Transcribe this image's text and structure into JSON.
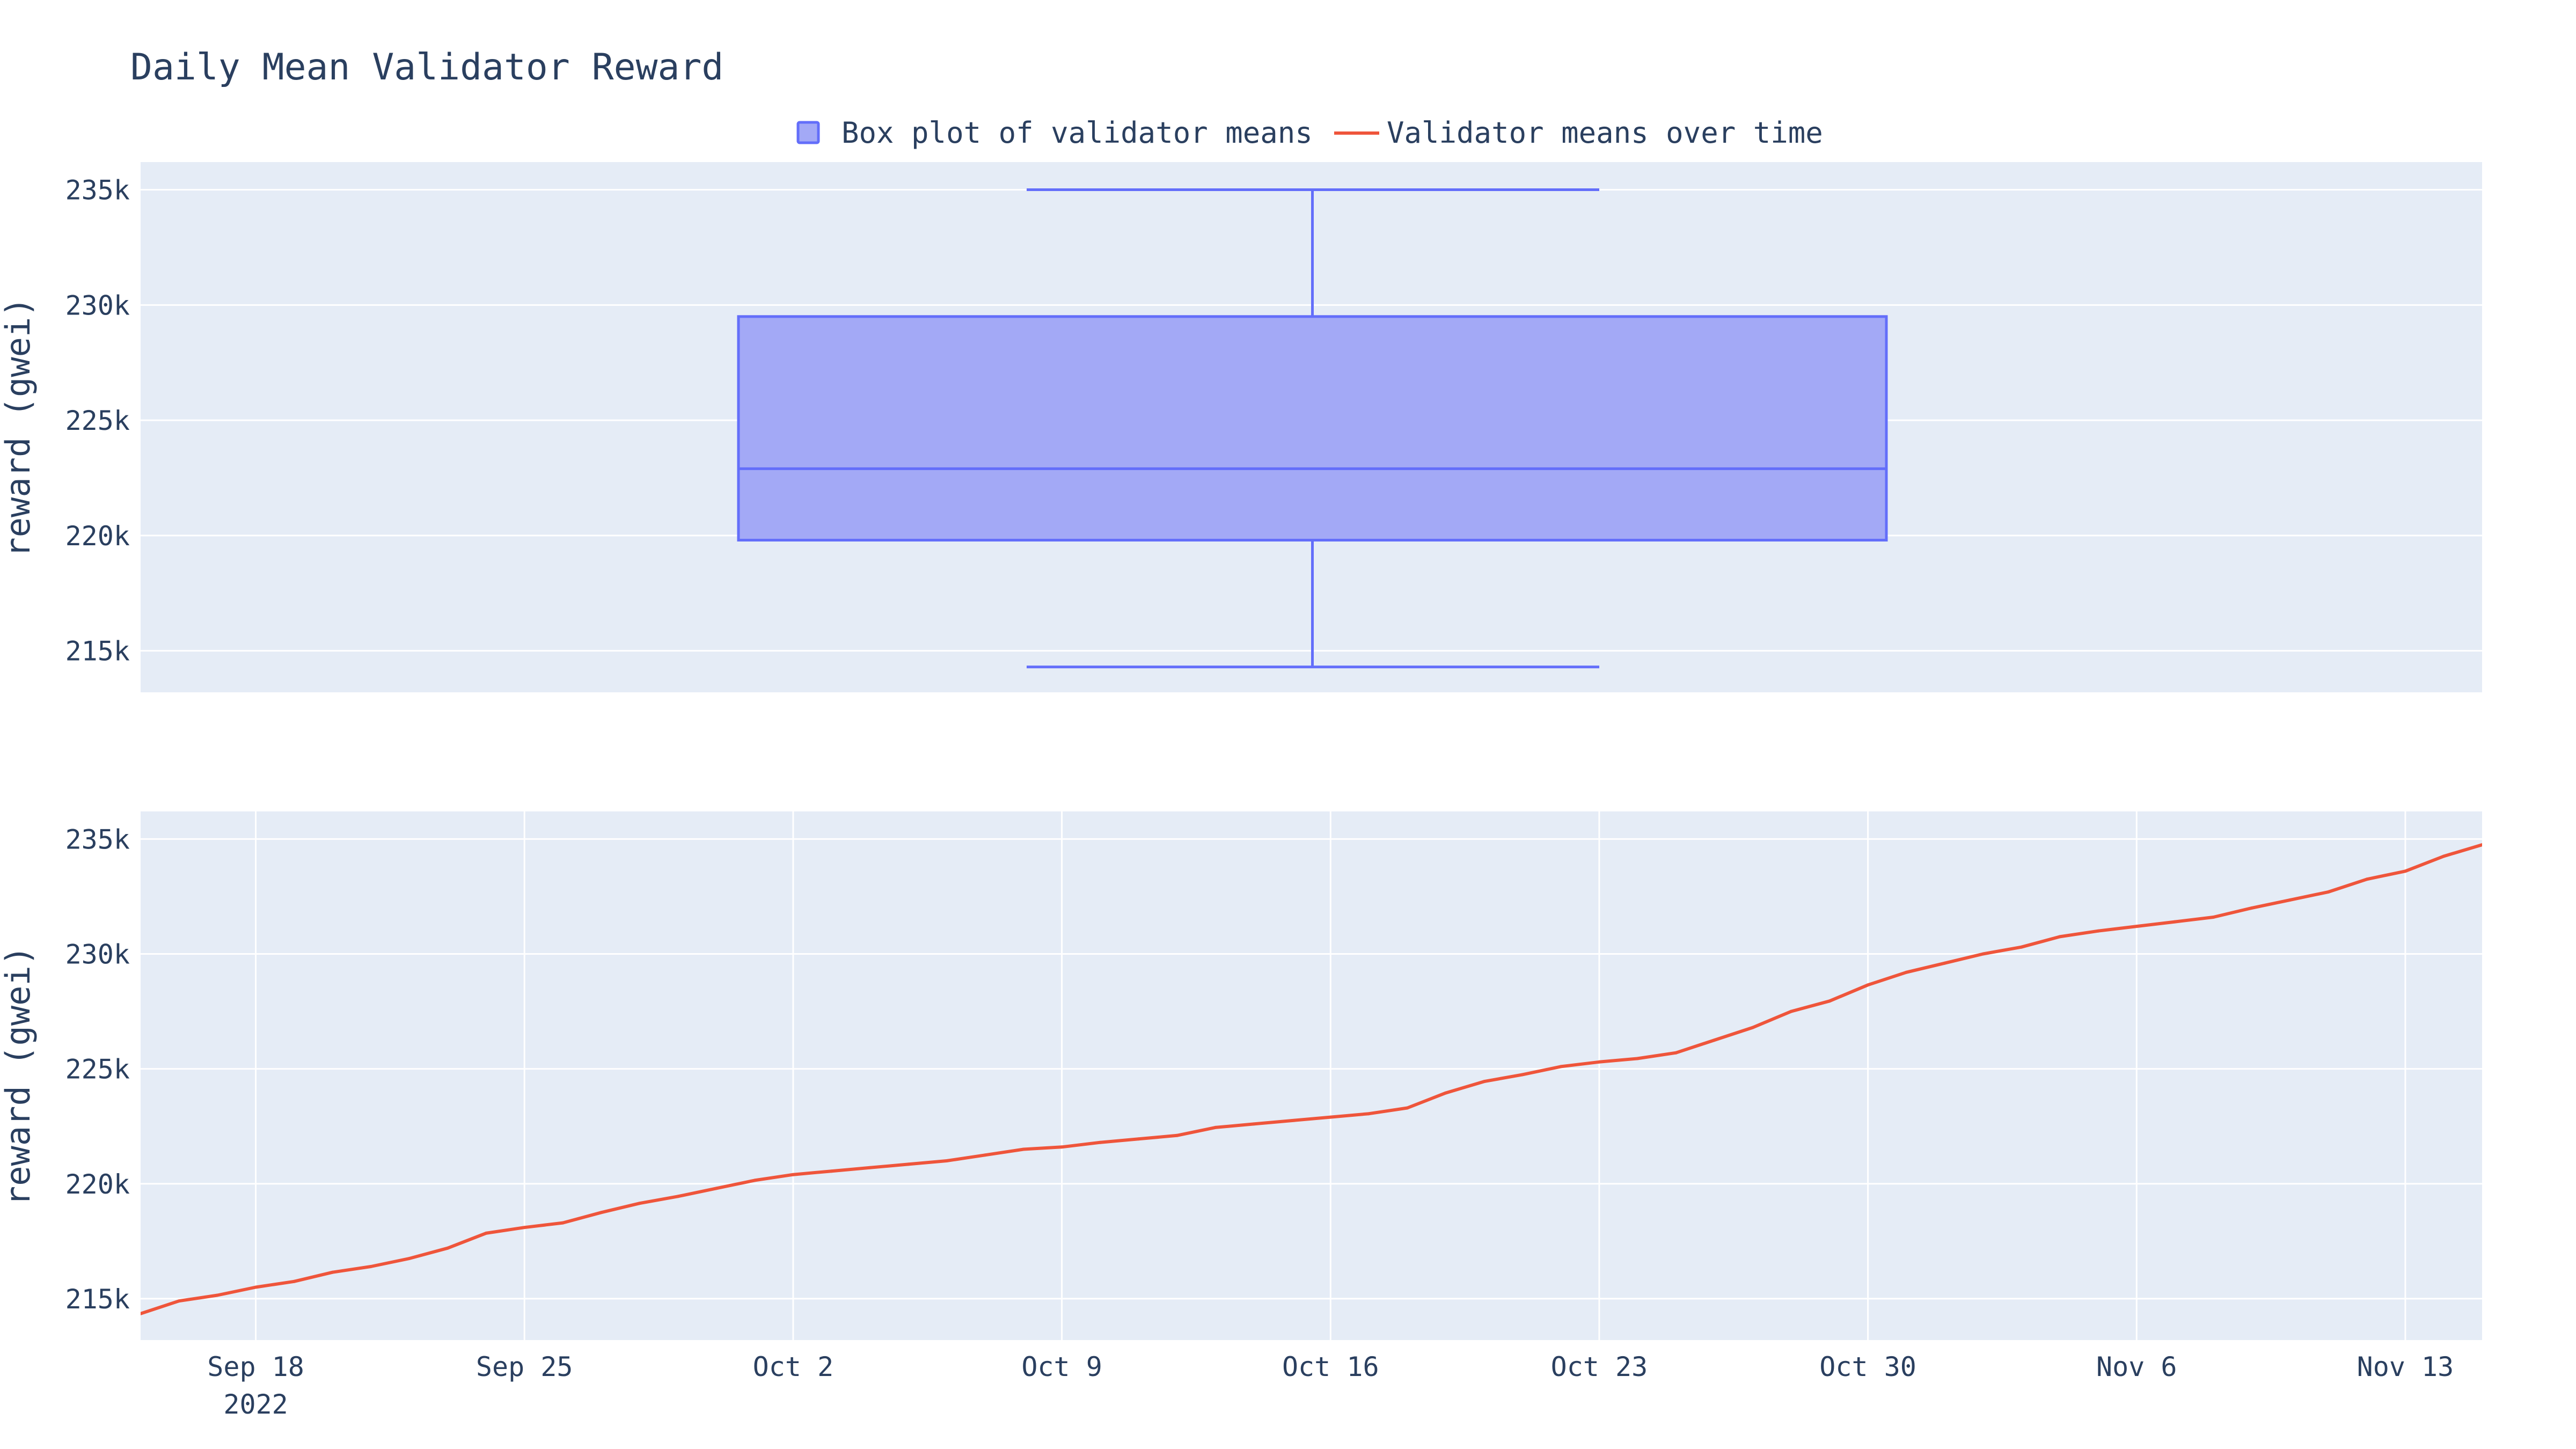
{
  "title": "Daily Mean Validator Reward",
  "legend": {
    "items": [
      {
        "label": "Box plot of validator means",
        "color": "#636efa",
        "kind": "box"
      },
      {
        "label": "Validator means over time",
        "color": "#ef553b",
        "kind": "line"
      }
    ]
  },
  "colors": {
    "plot_bg": "#e5ecf6",
    "grid": "#ffffff",
    "text": "#2a3f5f",
    "box_line": "#636efa",
    "box_fill": "#a3a9f6",
    "line": "#ef553b"
  },
  "chart_data": [
    {
      "type": "box",
      "ylabel": "reward (gwei)",
      "ylim": [
        213200,
        236200
      ],
      "yticks": [
        215000,
        220000,
        225000,
        230000,
        235000
      ],
      "ytick_labels": [
        "215k",
        "220k",
        "225k",
        "230k",
        "235k"
      ],
      "grid": true,
      "stats": {
        "min": 214300,
        "q1": 219800,
        "median": 222900,
        "q3": 229500,
        "max": 235000
      }
    },
    {
      "type": "line",
      "xlabel": "",
      "ylabel": "reward (gwei)",
      "xlim": [
        "2022-09-15",
        "2022-11-15"
      ],
      "ylim": [
        213200,
        236200
      ],
      "yticks": [
        215000,
        220000,
        225000,
        230000,
        235000
      ],
      "ytick_labels": [
        "215k",
        "220k",
        "225k",
        "230k",
        "235k"
      ],
      "xticks": [
        "2022-09-18",
        "2022-09-25",
        "2022-10-02",
        "2022-10-09",
        "2022-10-16",
        "2022-10-23",
        "2022-10-30",
        "2022-11-06",
        "2022-11-13"
      ],
      "xtick_labels": [
        "Sep 18",
        "Sep 25",
        "Oct 2",
        "Oct 9",
        "Oct 16",
        "Oct 23",
        "Oct 30",
        "Nov 6",
        "Nov 13"
      ],
      "xtick_year_label": "2022",
      "grid": true,
      "series": [
        {
          "x": [
            "2022-09-15",
            "2022-09-16",
            "2022-09-17",
            "2022-09-18",
            "2022-09-19",
            "2022-09-20",
            "2022-09-21",
            "2022-09-22",
            "2022-09-23",
            "2022-09-24",
            "2022-09-25",
            "2022-09-26",
            "2022-09-27",
            "2022-09-28",
            "2022-09-29",
            "2022-09-30",
            "2022-10-01",
            "2022-10-02",
            "2022-10-03",
            "2022-10-04",
            "2022-10-05",
            "2022-10-06",
            "2022-10-07",
            "2022-10-08",
            "2022-10-09",
            "2022-10-10",
            "2022-10-11",
            "2022-10-12",
            "2022-10-13",
            "2022-10-14",
            "2022-10-15",
            "2022-10-16",
            "2022-10-17",
            "2022-10-18",
            "2022-10-19",
            "2022-10-20",
            "2022-10-21",
            "2022-10-22",
            "2022-10-23",
            "2022-10-24",
            "2022-10-25",
            "2022-10-26",
            "2022-10-27",
            "2022-10-28",
            "2022-10-29",
            "2022-10-30",
            "2022-10-31",
            "2022-11-01",
            "2022-11-02",
            "2022-11-03",
            "2022-11-04",
            "2022-11-05",
            "2022-11-06",
            "2022-11-07",
            "2022-11-08",
            "2022-11-09",
            "2022-11-10",
            "2022-11-11",
            "2022-11-12",
            "2022-11-13",
            "2022-11-14",
            "2022-11-15"
          ],
          "y": [
            214350,
            214900,
            215150,
            215500,
            215750,
            216150,
            216400,
            216750,
            217200,
            217850,
            218100,
            218300,
            218750,
            219150,
            219450,
            219800,
            220150,
            220400,
            220550,
            220700,
            220850,
            221000,
            221250,
            221500,
            221600,
            221800,
            221950,
            222100,
            222450,
            222600,
            222750,
            222900,
            223050,
            223300,
            223950,
            224450,
            224750,
            225100,
            225300,
            225450,
            225700,
            226250,
            226800,
            227500,
            227950,
            228650,
            229200,
            229600,
            230000,
            230300,
            230750,
            231000,
            231200,
            231400,
            231600,
            232000,
            232350,
            232700,
            233250,
            233600,
            234250,
            234750
          ]
        }
      ]
    }
  ]
}
